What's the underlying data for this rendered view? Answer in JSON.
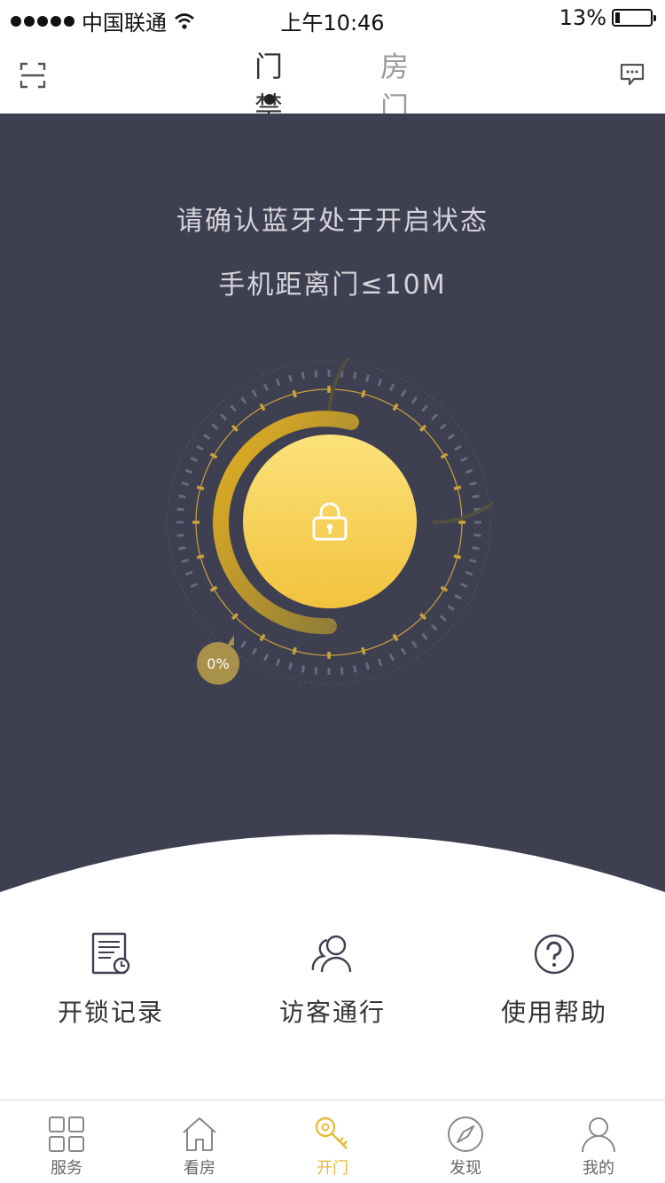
{
  "status_bar": {
    "carrier": "中国联通",
    "time": "上午10:46",
    "battery": "13%",
    "battery_level": 0.13
  },
  "nav": {
    "tabs": [
      {
        "label": "门禁",
        "active": true
      },
      {
        "label": "房门",
        "active": false
      }
    ],
    "left_icon": "scan-icon",
    "right_icon": "message-icon"
  },
  "panel": {
    "tip_line1": "请确认蓝牙处于开启状态",
    "tip_line2": "手机距离门≤10M",
    "progress_label": "0%",
    "progress": 0,
    "accent": "#f2c23d",
    "background": "#3f3f52"
  },
  "actions": [
    {
      "label": "开锁记录",
      "icon": "unlock-record-icon"
    },
    {
      "label": "访客通行",
      "icon": "visitors-icon"
    },
    {
      "label": "使用帮助",
      "icon": "help-icon"
    }
  ],
  "tabbar": [
    {
      "label": "服务",
      "icon": "grid-icon",
      "active": false
    },
    {
      "label": "看房",
      "icon": "house-icon",
      "active": false
    },
    {
      "label": "开门",
      "icon": "key-icon",
      "active": true
    },
    {
      "label": "发现",
      "icon": "compass-icon",
      "active": false
    },
    {
      "label": "我的",
      "icon": "user-icon",
      "active": false
    }
  ]
}
